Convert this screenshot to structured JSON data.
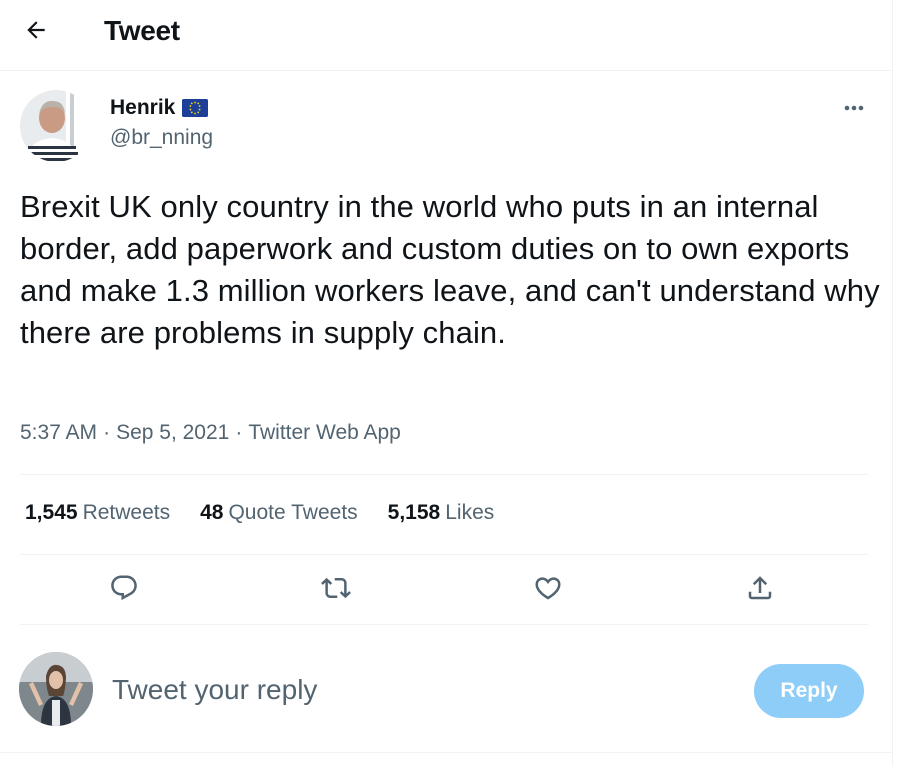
{
  "header": {
    "title": "Tweet",
    "back_icon": "arrow-left-icon"
  },
  "tweet": {
    "author_name": "Henrik",
    "author_badge_icon": "eu-flag-icon",
    "author_handle": "@br_nning",
    "more_icon": "more-icon",
    "text": "Brexit UK only country in the world who puts in an internal border, add paperwork and custom duties on to own exports and make 1.3 million workers leave, and can't understand why there are problems in supply chain.",
    "time": "5:37 AM",
    "date": "Sep 5, 2021",
    "separator": "·",
    "source": "Twitter Web App"
  },
  "stats": {
    "retweets_count": "1,545",
    "retweets_label": "Retweets",
    "quotes_count": "48",
    "quotes_label": "Quote Tweets",
    "likes_count": "5,158",
    "likes_label": "Likes"
  },
  "actions": [
    {
      "icon": "reply-icon"
    },
    {
      "icon": "retweet-icon"
    },
    {
      "icon": "like-icon"
    },
    {
      "icon": "share-icon"
    }
  ],
  "reply": {
    "placeholder": "Tweet your reply",
    "button_label": "Reply"
  },
  "colors": {
    "text": "#0f1419",
    "secondary_text": "#536471",
    "border": "#eff3f4",
    "reply_button_disabled": "#8ecdf8",
    "eu_flag_blue": "#1d3f9a",
    "eu_flag_stars": "#ffd700"
  }
}
